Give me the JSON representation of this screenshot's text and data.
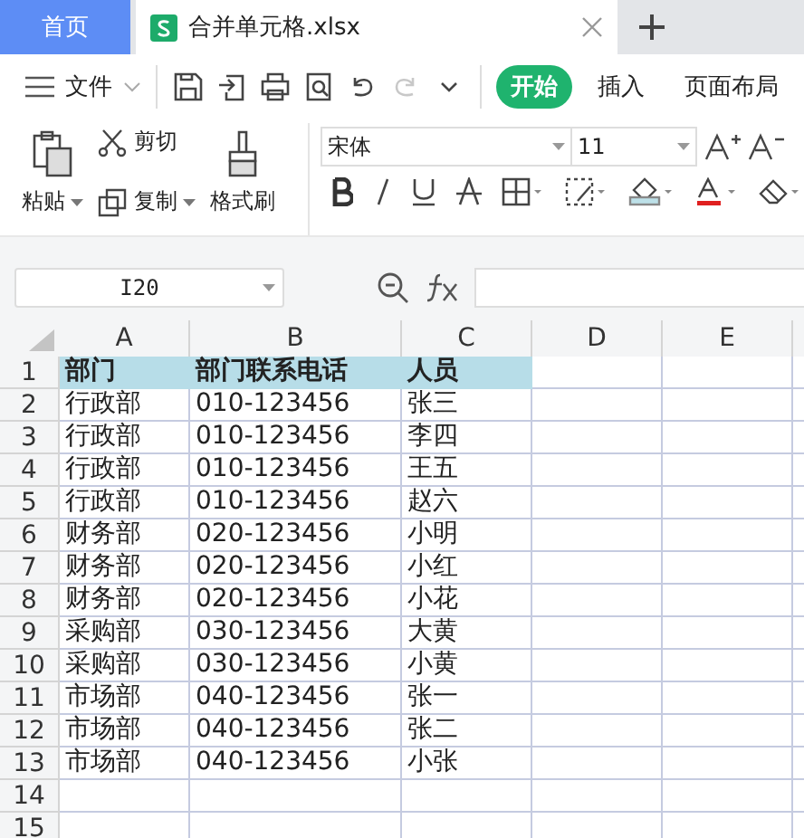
{
  "tabs": [
    {
      "label": "首页",
      "selected": false
    },
    {
      "label": "合并单元格.xlsx",
      "selected": true
    }
  ],
  "quick_tools": [
    {
      "kind": "save",
      "disabled": false
    },
    {
      "kind": "export",
      "disabled": false
    },
    {
      "kind": "print",
      "disabled": false
    },
    {
      "kind": "preview",
      "disabled": false
    },
    {
      "kind": "undo",
      "disabled": false
    },
    {
      "kind": "redo",
      "disabled": true
    },
    {
      "kind": "more",
      "disabled": false
    }
  ],
  "file_menu": "文件",
  "ribbon_tabs": [
    {
      "label": "开始",
      "selected": true
    },
    {
      "label": "插入",
      "selected": false
    },
    {
      "label": "页面布局",
      "selected": false
    }
  ],
  "clipboard": {
    "paste": "粘贴",
    "cut": "剪切",
    "copy": "复制",
    "format_painter": "格式刷"
  },
  "font": {
    "name": "宋体",
    "size": "11"
  },
  "name_box": "I20",
  "columns": [
    "A",
    "B",
    "C",
    "D",
    "E"
  ],
  "header_row": {
    "number": "1",
    "cells": [
      "部门",
      "部门联系电话",
      "人员"
    ]
  },
  "rows": [
    {
      "number": "2",
      "cells": [
        "行政部",
        "010-123456",
        "张三"
      ]
    },
    {
      "number": "3",
      "cells": [
        "行政部",
        "010-123456",
        "李四"
      ]
    },
    {
      "number": "4",
      "cells": [
        "行政部",
        "010-123456",
        "王五"
      ]
    },
    {
      "number": "5",
      "cells": [
        "行政部",
        "010-123456",
        "赵六"
      ]
    },
    {
      "number": "6",
      "cells": [
        "财务部",
        "020-123456",
        "小明"
      ]
    },
    {
      "number": "7",
      "cells": [
        "财务部",
        "020-123456",
        "小红"
      ]
    },
    {
      "number": "8",
      "cells": [
        "财务部",
        "020-123456",
        "小花"
      ]
    },
    {
      "number": "9",
      "cells": [
        "采购部",
        "030-123456",
        "大黄"
      ]
    },
    {
      "number": "10",
      "cells": [
        "采购部",
        "030-123456",
        "小黄"
      ]
    },
    {
      "number": "11",
      "cells": [
        "市场部",
        "040-123456",
        "张一"
      ]
    },
    {
      "number": "12",
      "cells": [
        "市场部",
        "040-123456",
        "张二"
      ]
    },
    {
      "number": "13",
      "cells": [
        "市场部",
        "040-123456",
        "小张"
      ]
    },
    {
      "number": "14",
      "cells": []
    },
    {
      "number": "15",
      "cells": []
    }
  ]
}
